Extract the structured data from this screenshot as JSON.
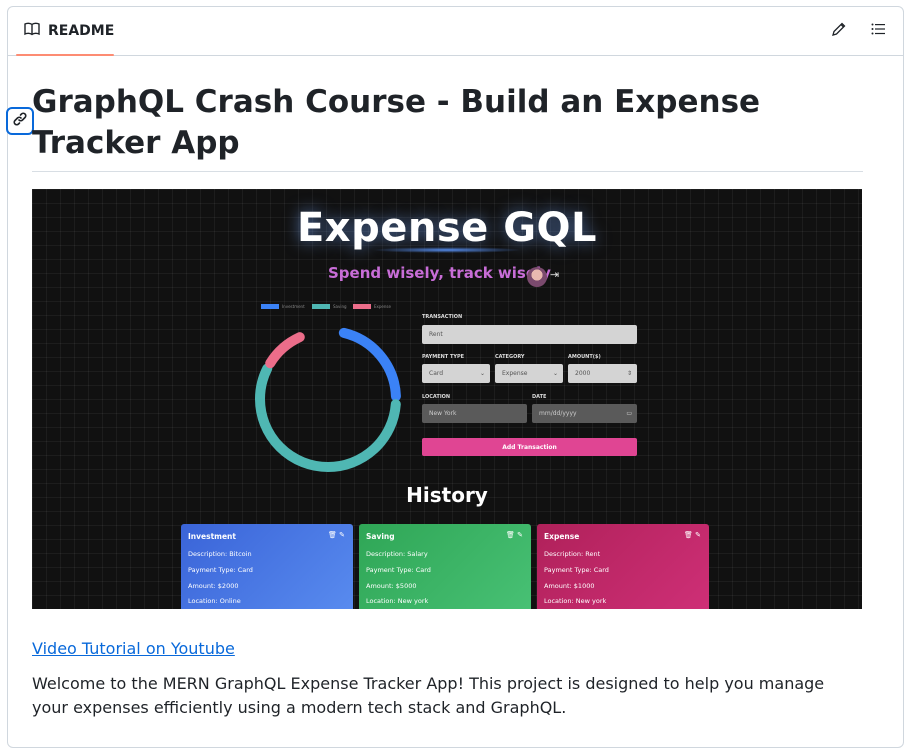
{
  "header": {
    "tab_label": "README",
    "tab_icon": "book-icon",
    "edit_icon": "pencil-icon",
    "outline_icon": "list-icon"
  },
  "title": "GraphQL Crash Course - Build an Expense Tracker App",
  "screenshot": {
    "app_title": "Expense GQL",
    "subtitle": "Spend wisely, track wisely",
    "legend": [
      {
        "label": "Investment",
        "color": "#3b82f6"
      },
      {
        "label": "Saving",
        "color": "#4fb7b3"
      },
      {
        "label": "Expense",
        "color": "#ec6d8a"
      }
    ],
    "form": {
      "transaction_label": "TRANSACTION",
      "transaction_value": "Rent",
      "payment_type_label": "PAYMENT TYPE",
      "payment_type_value": "Card",
      "category_label": "CATEGORY",
      "category_value": "Expense",
      "amount_label": "AMOUNT($)",
      "amount_value": "2000",
      "location_label": "LOCATION",
      "location_placeholder": "New York",
      "date_label": "DATE",
      "date_placeholder": "mm/dd/yyyy",
      "submit_label": "Add Transaction"
    },
    "history_title": "History",
    "cards": [
      {
        "title": "Investment",
        "description": "Description: Bitcoin",
        "payment": "Payment Type: Card",
        "amount": "Amount: $2000",
        "location": "Location: Online"
      },
      {
        "title": "Saving",
        "description": "Description: Salary",
        "payment": "Payment Type: Card",
        "amount": "Amount: $5000",
        "location": "Location: New york"
      },
      {
        "title": "Expense",
        "description": "Description: Rent",
        "payment": "Payment Type: Card",
        "amount": "Amount: $1000",
        "location": "Location: New york"
      }
    ]
  },
  "link_text": "Video Tutorial on Youtube",
  "intro": "Welcome to the MERN GraphQL Expense Tracker App! This project is designed to help you manage your expenses efficiently using a modern tech stack and GraphQL."
}
